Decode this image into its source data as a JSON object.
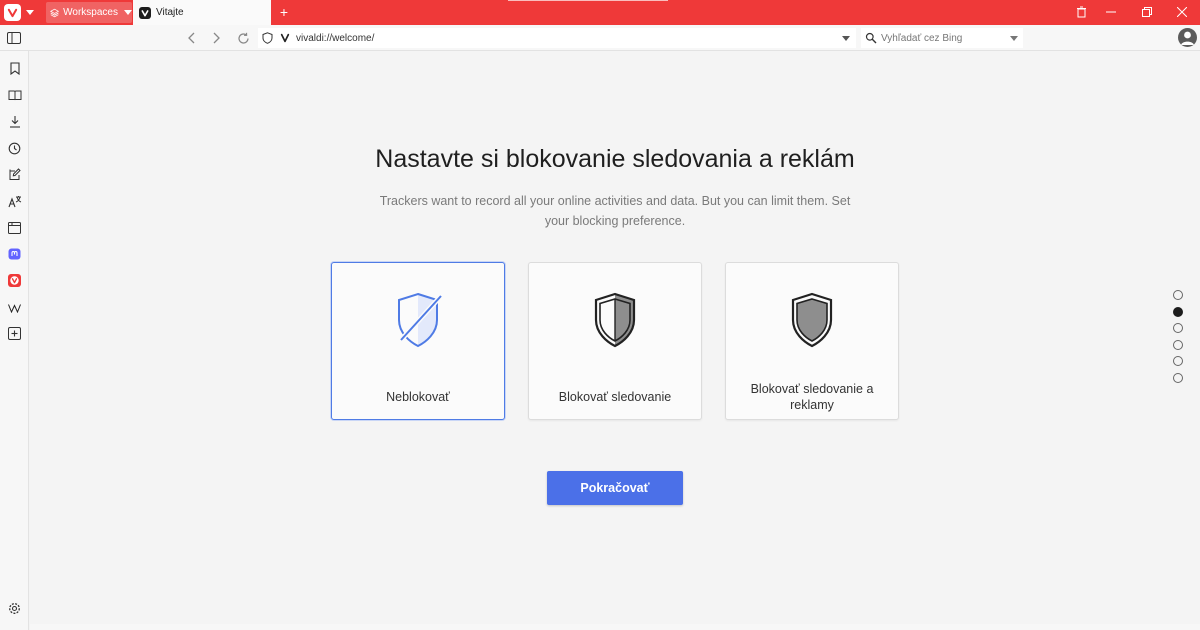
{
  "titlebar": {
    "workspaces_label": "Workspaces",
    "tab_title": "Vitajte",
    "new_tab_symbol": "+",
    "accent_color": "#ef3939"
  },
  "addressbar": {
    "url": "vivaldi://welcome/",
    "search_placeholder": "Vyhľadať cez Bing"
  },
  "page": {
    "heading": "Nastavte si blokovanie sledovania a reklám",
    "subtitle": "Trackers want to record all your online activities and data. But you can limit them. Set your blocking preference.",
    "options": [
      {
        "label": "Neblokovať",
        "selected": true,
        "icon": "shield-off-icon"
      },
      {
        "label": "Blokovať sledovanie",
        "selected": false,
        "icon": "shield-half-icon"
      },
      {
        "label": "Blokovať sledovanie a reklamy",
        "selected": false,
        "icon": "shield-full-icon"
      }
    ],
    "continue_label": "Pokračovať",
    "step_current": 2,
    "step_total": 6
  },
  "colors": {
    "primary": "#4b70e8",
    "selected_border": "#4f7be5"
  }
}
